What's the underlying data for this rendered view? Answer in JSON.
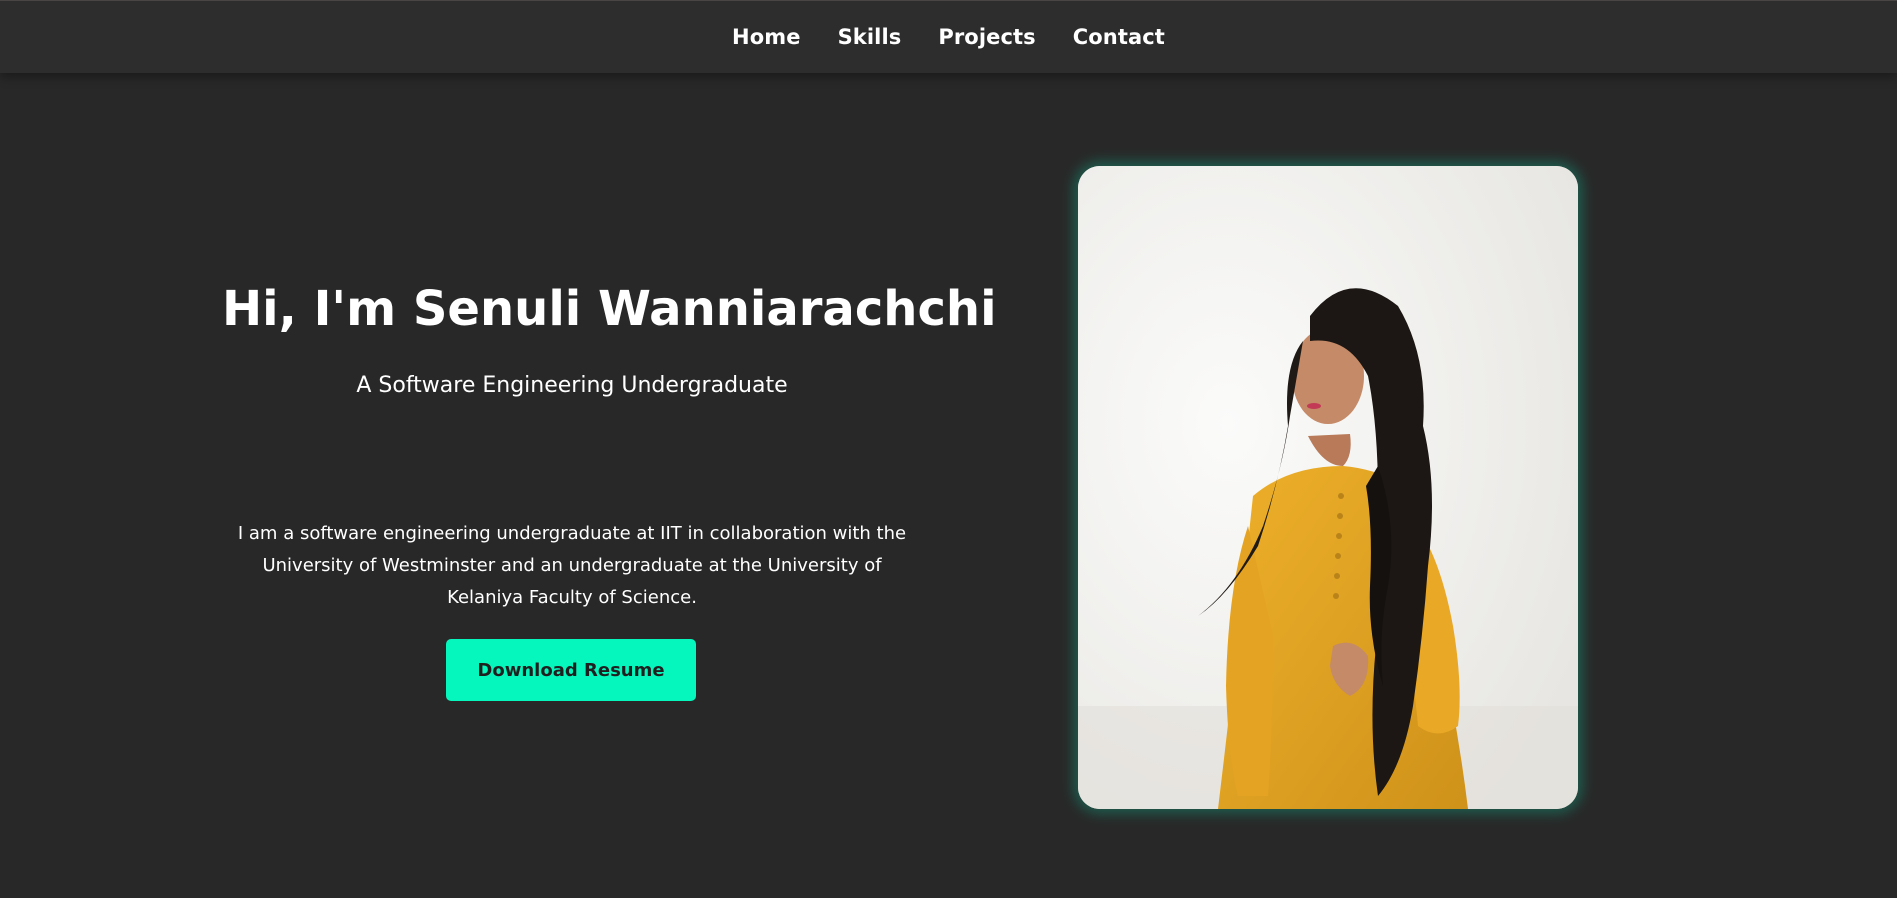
{
  "nav": {
    "items": [
      {
        "label": "Home"
      },
      {
        "label": "Skills"
      },
      {
        "label": "Projects"
      },
      {
        "label": "Contact"
      }
    ]
  },
  "hero": {
    "title": "Hi, I'm Senuli Wanniarachchi",
    "subtitle": "A Software Engineering Undergraduate",
    "bio": "I am a software engineering undergraduate at IIT in collaboration with the University of Westminster and an undergraduate at the University of Kelaniya Faculty of Science.",
    "button_label": "Download Resume"
  },
  "photo": {
    "alt": "Portrait photo"
  },
  "colors": {
    "background": "#282828",
    "navbar": "#2d2d2d",
    "accent": "#05f7bd",
    "text": "#ffffff",
    "dress": "#e3a522"
  }
}
